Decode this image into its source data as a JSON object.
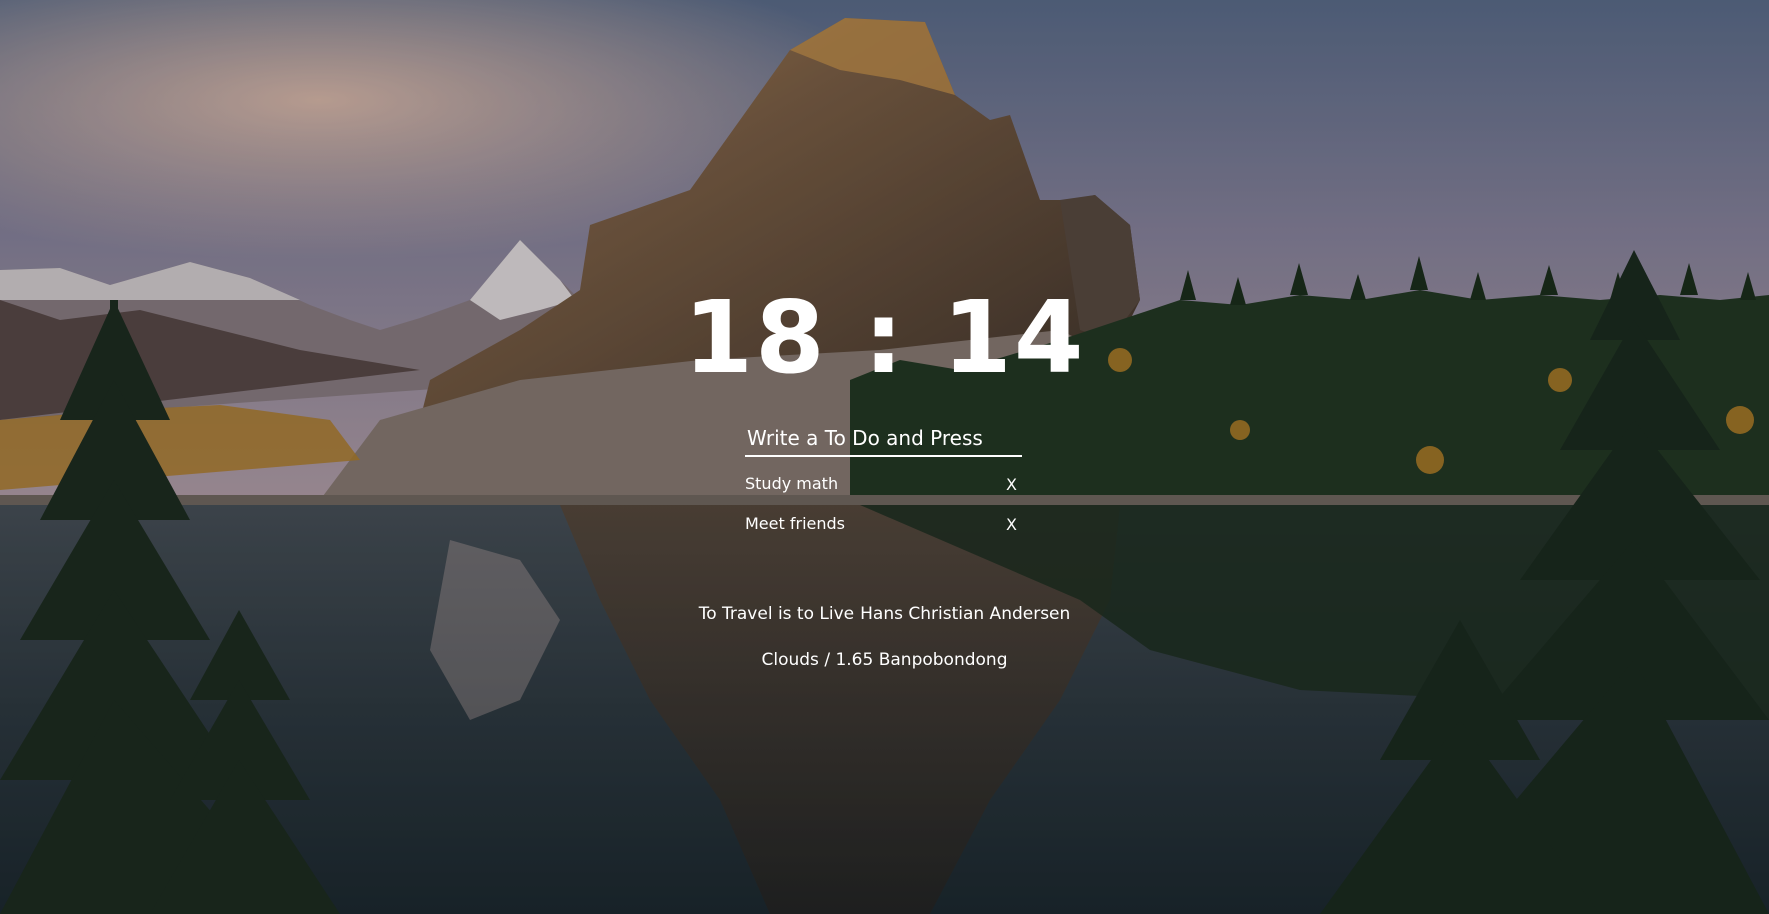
{
  "background": {
    "photo": "mountain-lake-sunset"
  },
  "clock": {
    "time": "18 : 14"
  },
  "todo": {
    "placeholder": "Write a To Do and Press",
    "delete_label": "X",
    "items": [
      {
        "text": "Study math"
      },
      {
        "text": "Meet friends"
      }
    ]
  },
  "quote": {
    "text": "To Travel is to Live",
    "author": "Hans Christian Andersen"
  },
  "weather": {
    "summary": "Clouds / 1.65",
    "location": "Banpobondong"
  }
}
